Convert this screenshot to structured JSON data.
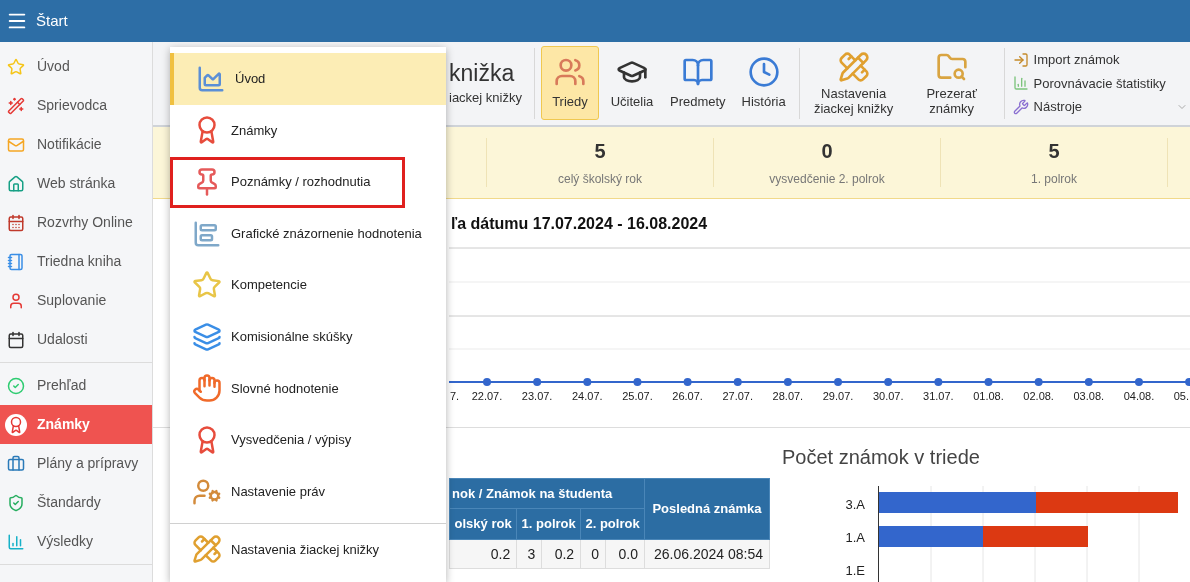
{
  "header": {
    "title": "Štart"
  },
  "sidebar": {
    "groups": [
      [
        {
          "label": "Úvod",
          "selected": false
        },
        {
          "label": "Sprievodca",
          "selected": false
        },
        {
          "label": "Notifikácie",
          "selected": false
        },
        {
          "label": "Web stránka",
          "selected": false
        },
        {
          "label": "Rozvrhy Online",
          "selected": false
        },
        {
          "label": "Triedna kniha",
          "selected": false
        },
        {
          "label": "Suplovanie",
          "selected": false
        },
        {
          "label": "Udalosti",
          "selected": false
        }
      ],
      [
        {
          "label": "Prehľad",
          "selected": false
        },
        {
          "label": "Známky",
          "selected": true
        },
        {
          "label": "Plány a prípravy",
          "selected": false
        },
        {
          "label": "Štandardy",
          "selected": false
        },
        {
          "label": "Výsledky",
          "selected": false
        }
      ]
    ]
  },
  "toolbar": {
    "title": "knižka",
    "subtitle": "iackej knižky",
    "buttons": [
      {
        "label": "Triedy",
        "selected": true
      },
      {
        "label": "Učitelia",
        "selected": false
      },
      {
        "label": "Predmety",
        "selected": false
      },
      {
        "label": "História",
        "selected": false
      }
    ],
    "settings_buttons": [
      {
        "label": "Nastavenia žiackej knižky"
      },
      {
        "label": "Prezerať známky"
      }
    ],
    "links": [
      "Import známok",
      "Porovnávacie štatistiky",
      "Nástroje"
    ]
  },
  "stats": [
    {
      "value": "5",
      "label": "celý školský rok"
    },
    {
      "value": "0",
      "label": "vysvedčenie 2. polrok"
    },
    {
      "value": "5",
      "label": "1. polrok"
    }
  ],
  "timeline": {
    "title": "ľa dátumu 17.07.2024 - 16.08.2024",
    "x_labels": [
      "7.",
      "22.07.",
      "23.07.",
      "24.07.",
      "25.07.",
      "26.07.",
      "27.07.",
      "28.07.",
      "29.07.",
      "30.07.",
      "31.07.",
      "01.08.",
      "02.08.",
      "03.08.",
      "04.08.",
      "05."
    ]
  },
  "table": {
    "group_header": "nok / Známok na študenta",
    "last_header": "Posledná známka",
    "columns": [
      {
        "label": "olský rok"
      },
      {
        "label": "1. polrok",
        "colspan": 2
      },
      {
        "label": "2. polrok",
        "colspan": 2
      }
    ],
    "rows": [
      [
        "0.2",
        "3",
        "0.2",
        "0",
        "0.0",
        "26.06.2024 08:54"
      ]
    ]
  },
  "class_chart": {
    "title": "Počet známok v triede",
    "categories": [
      "3.A",
      "1.A",
      "1.E"
    ]
  },
  "menu": {
    "items": [
      {
        "label": "Úvod",
        "selected": true,
        "highlighted": false
      },
      {
        "label": "Známky",
        "selected": false,
        "highlighted": false
      },
      {
        "label": "Poznámky / rozhodnutia",
        "selected": false,
        "highlighted": true
      },
      {
        "label": "Grafické znázornenie hodnotenia",
        "selected": false,
        "highlighted": false
      },
      {
        "label": "Kompetencie",
        "selected": false,
        "highlighted": false
      },
      {
        "label": "Komisionálne skúšky",
        "selected": false,
        "highlighted": false
      },
      {
        "label": "Slovné hodnotenie",
        "selected": false,
        "highlighted": false
      },
      {
        "label": "Vysvedčenia / výpisy",
        "selected": false,
        "highlighted": false
      },
      {
        "label": "Nastavenie práv",
        "selected": false,
        "highlighted": false
      }
    ],
    "footer_item": {
      "label": "Nastavenia žiackej knižky"
    }
  }
}
